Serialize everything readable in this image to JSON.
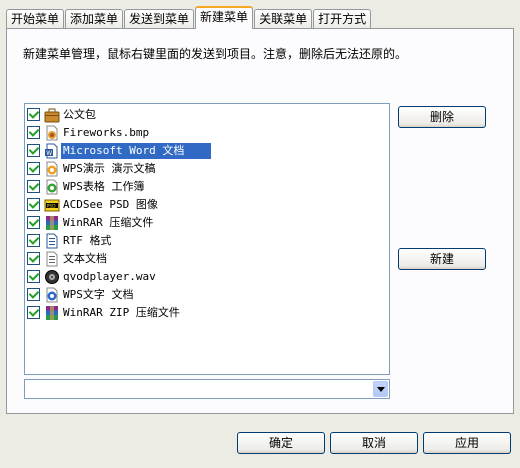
{
  "tabs": [
    "开始菜单",
    "添加菜单",
    "发送到菜单",
    "新建菜单",
    "关联菜单",
    "打开方式"
  ],
  "description": "新建菜单管理，鼠标右键里面的发送到项目。注意，删除后无法还原的。",
  "items": [
    {
      "label": "公文包",
      "checked": true,
      "icon": "briefcase-icon"
    },
    {
      "label": "Fireworks.bmp",
      "checked": true,
      "icon": "bmp-file-icon"
    },
    {
      "label": "Microsoft Word 文档",
      "checked": true,
      "icon": "word-doc-icon",
      "selected": true
    },
    {
      "label": "WPS演示 演示文稿",
      "checked": true,
      "icon": "wps-presentation-icon"
    },
    {
      "label": "WPS表格 工作簿",
      "checked": true,
      "icon": "wps-spreadsheet-icon"
    },
    {
      "label": "ACDSee PSD 图像",
      "checked": true,
      "icon": "psd-image-icon"
    },
    {
      "label": "WinRAR 压缩文件",
      "checked": true,
      "icon": "winrar-archive-icon"
    },
    {
      "label": "RTF 格式",
      "checked": true,
      "icon": "rtf-file-icon"
    },
    {
      "label": "文本文档",
      "checked": true,
      "icon": "text-file-icon"
    },
    {
      "label": "qvodplayer.wav",
      "checked": true,
      "icon": "wav-file-icon"
    },
    {
      "label": "WPS文字 文档",
      "checked": true,
      "icon": "wps-document-icon"
    },
    {
      "label": "WinRAR ZIP 压缩文件",
      "checked": true,
      "icon": "winrar-zip-icon"
    }
  ],
  "combo": {
    "value": ""
  },
  "buttons": {
    "delete": "删除",
    "new": "新建",
    "ok": "确定",
    "cancel": "取消",
    "apply": "应用"
  }
}
